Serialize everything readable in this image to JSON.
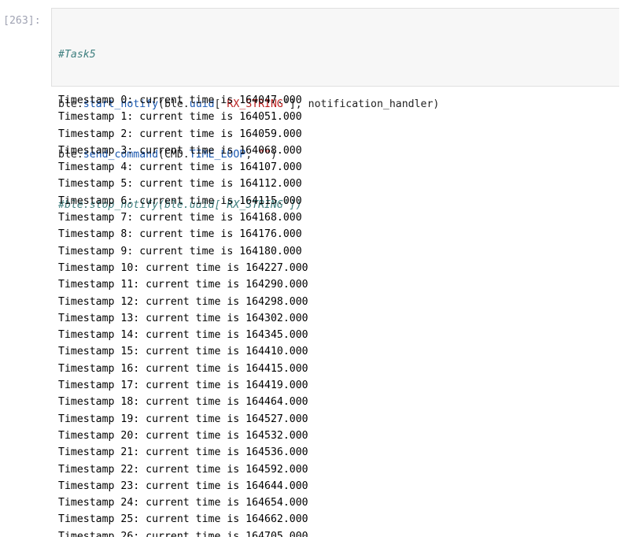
{
  "cell": {
    "prompt": "[263]:",
    "code": {
      "line1": "#Task5",
      "line2": {
        "a": "ble.",
        "b": "start_notify",
        "c": "(ble.",
        "d": "uuid",
        "e": "['",
        "f": "RX_STRING",
        "g": "'], notification_handler)"
      },
      "line3": {
        "a": "ble.",
        "b": "send_command",
        "c": "(CMD.",
        "d": "TIME_LOOP",
        "e": ", ",
        "f": "\"\"",
        "g": ")"
      },
      "line4": "#ble.stop_notify(ble.uuid['RX_STRING'])"
    },
    "output_lines": [
      "Timestamp 0: current time is 164047.000",
      "Timestamp 1: current time is 164051.000",
      "Timestamp 2: current time is 164059.000",
      "Timestamp 3: current time is 164068.000",
      "Timestamp 4: current time is 164107.000",
      "Timestamp 5: current time is 164112.000",
      "Timestamp 6: current time is 164115.000",
      "Timestamp 7: current time is 164168.000",
      "Timestamp 8: current time is 164176.000",
      "Timestamp 9: current time is 164180.000",
      "Timestamp 10: current time is 164227.000",
      "Timestamp 11: current time is 164290.000",
      "Timestamp 12: current time is 164298.000",
      "Timestamp 13: current time is 164302.000",
      "Timestamp 14: current time is 164345.000",
      "Timestamp 15: current time is 164410.000",
      "Timestamp 16: current time is 164415.000",
      "Timestamp 17: current time is 164419.000",
      "Timestamp 18: current time is 164464.000",
      "Timestamp 19: current time is 164527.000",
      "Timestamp 20: current time is 164532.000",
      "Timestamp 21: current time is 164536.000",
      "Timestamp 22: current time is 164592.000",
      "Timestamp 23: current time is 164644.000",
      "Timestamp 24: current time is 164654.000",
      "Timestamp 25: current time is 164662.000",
      "Timestamp 26: current time is 164705.000"
    ]
  }
}
